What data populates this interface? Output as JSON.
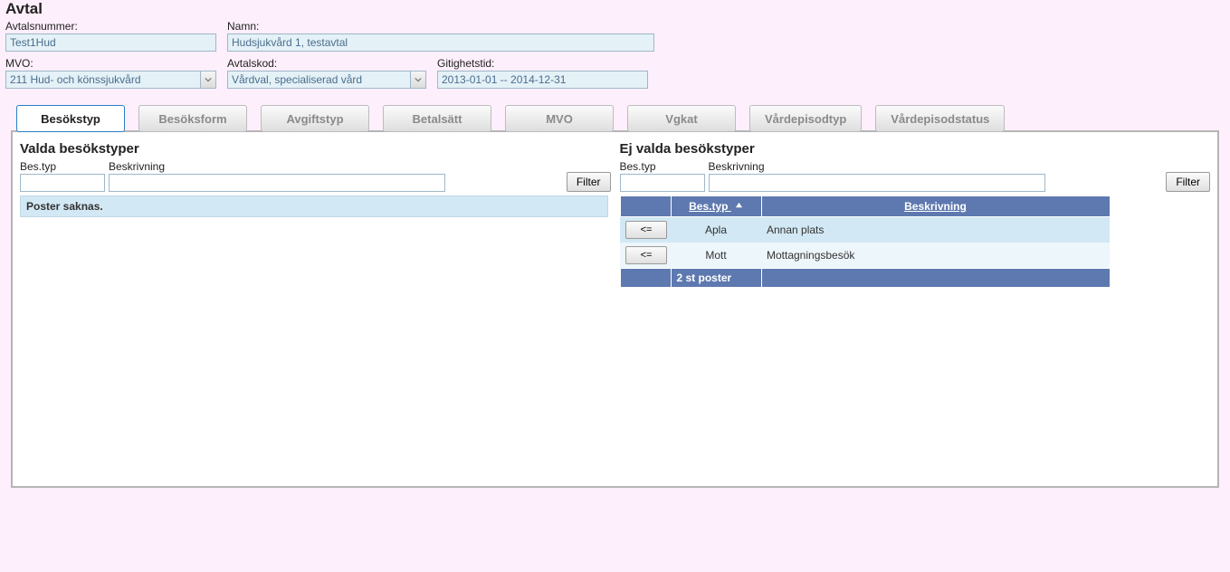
{
  "header": {
    "title": "Avtal",
    "fields": {
      "avtalsnummer_label": "Avtalsnummer:",
      "avtalsnummer": "Test1Hud",
      "namn_label": "Namn:",
      "namn": "Hudsjukvård 1, testavtal",
      "mvo_label": "MVO:",
      "mvo": "211 Hud- och könssjukvård",
      "avtalskod_label": "Avtalskod:",
      "avtalskod": "Vårdval, specialiserad vård",
      "giltighetstid_label": "Gitighetstid:",
      "giltighetstid": "2013-01-01 -- 2014-12-31"
    }
  },
  "tabs": {
    "active": "Besökstyp",
    "list": [
      "Besökstyp",
      "Besöksform",
      "Avgiftstyp",
      "Betalsätt",
      "MVO",
      "Vgkat",
      "Vårdepisodtyp",
      "Vårdepisodstatus"
    ]
  },
  "left": {
    "title": "Valda besökstyper",
    "filter": {
      "type_label": "Bes.typ",
      "desc_label": "Beskrivning",
      "button": "Filter"
    },
    "empty": "Poster saknas."
  },
  "right": {
    "title": "Ej valda besökstyper",
    "filter": {
      "type_label": "Bes.typ",
      "desc_label": "Beskrivning",
      "button": "Filter"
    },
    "columns": {
      "type": "Bes.typ",
      "desc": "Beskrivning"
    },
    "move_button": "<=",
    "rows": [
      {
        "type": "Apla",
        "desc": "Annan plats"
      },
      {
        "type": "Mott",
        "desc": "Mottagningsbesök"
      }
    ],
    "footer": "2 st poster"
  }
}
